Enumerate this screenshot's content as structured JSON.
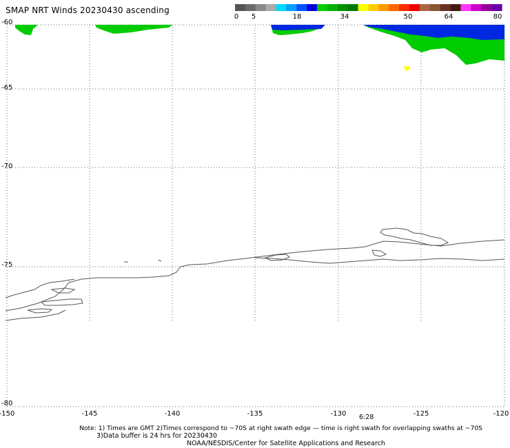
{
  "title": "SMAP NRT Winds 20230430 ascending",
  "colorbar": {
    "ticks": [
      "0",
      "5",
      "18",
      "34",
      "50",
      "64",
      "80"
    ],
    "segments": [
      "#555555",
      "#6a6a6a",
      "#8a8a8a",
      "#aaaaaa",
      "#00d8ff",
      "#00a0ff",
      "#0050ff",
      "#0000e0",
      "#00cc00",
      "#00b000",
      "#009000",
      "#007a00",
      "#ffff00",
      "#ffcc00",
      "#ff9900",
      "#ff6600",
      "#ff2a00",
      "#ee0000",
      "#aa6644",
      "#885533",
      "#663322",
      "#441a10",
      "#ff33ff",
      "#cc00cc",
      "#990099",
      "#6600aa"
    ]
  },
  "map": {
    "latitude_labels": [
      "-60",
      "-65",
      "-70",
      "-75",
      "-80"
    ],
    "longitude_labels": [
      "-150",
      "-145",
      "-140",
      "-135",
      "-130",
      "-125",
      "-120"
    ],
    "time_label": "6:28"
  },
  "notes": {
    "line1": "Note: 1) Times are GMT 2)Times correspond to ~70S at right swath edge — time is right swath for overlapping swaths at ~70S",
    "line2": "3)Data buffer is 24 hrs for 20230430",
    "line3": "NOAA/NESDIS/Center for Satellite Applications and Research"
  },
  "colors": {
    "wind_blue": "#0028e0",
    "wind_green": "#00cc00",
    "wind_yellow": "#ffff00",
    "coast": "#555555",
    "grid": "#666666"
  }
}
